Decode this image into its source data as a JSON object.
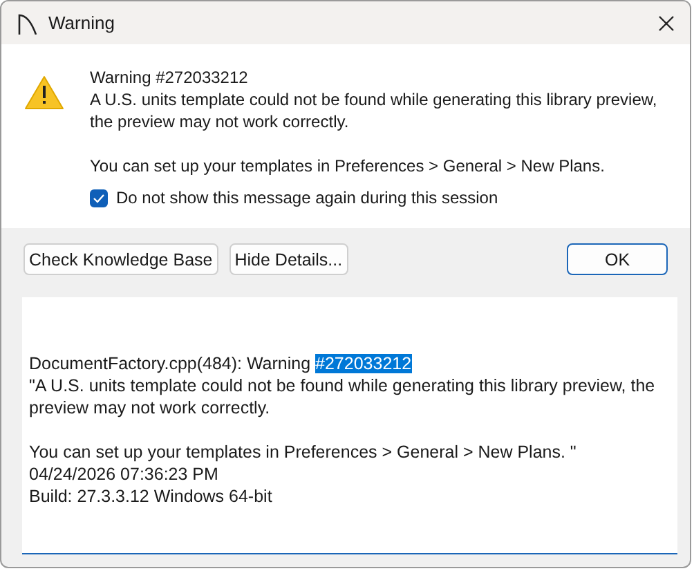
{
  "window": {
    "title": "Warning"
  },
  "message": {
    "heading": "Warning #272033212",
    "body": "A U.S. units template could not be found while generating this library preview, the preview may not work correctly.",
    "hint": "You can set up your templates in Preferences > General > New Plans."
  },
  "checkbox": {
    "label": "Do not show this message again during this session",
    "checked": true
  },
  "buttons": [
    {
      "label": "Check Knowledge Base",
      "kind": "plain"
    },
    {
      "label": "Hide Details...",
      "kind": "plain"
    },
    {
      "label": "OK",
      "kind": "default"
    }
  ],
  "details": {
    "paragraphs": [
      {
        "lines": [
          {
            "text": "DocumentFactory.cpp(484): Warning ",
            "selected_text": "#272033212"
          },
          {
            "text": "\"A U.S. units template could not be found while generating this library preview, the preview may not work correctly."
          }
        ]
      },
      {
        "lines": [
          {
            "text": "You can set up your templates in Preferences > General > New Plans. \""
          },
          {
            "text": "04/24/2026 07:36:23 PM"
          },
          {
            "text": "Build: 27.3.3.12 Windows 64-bit"
          }
        ]
      }
    ]
  }
}
